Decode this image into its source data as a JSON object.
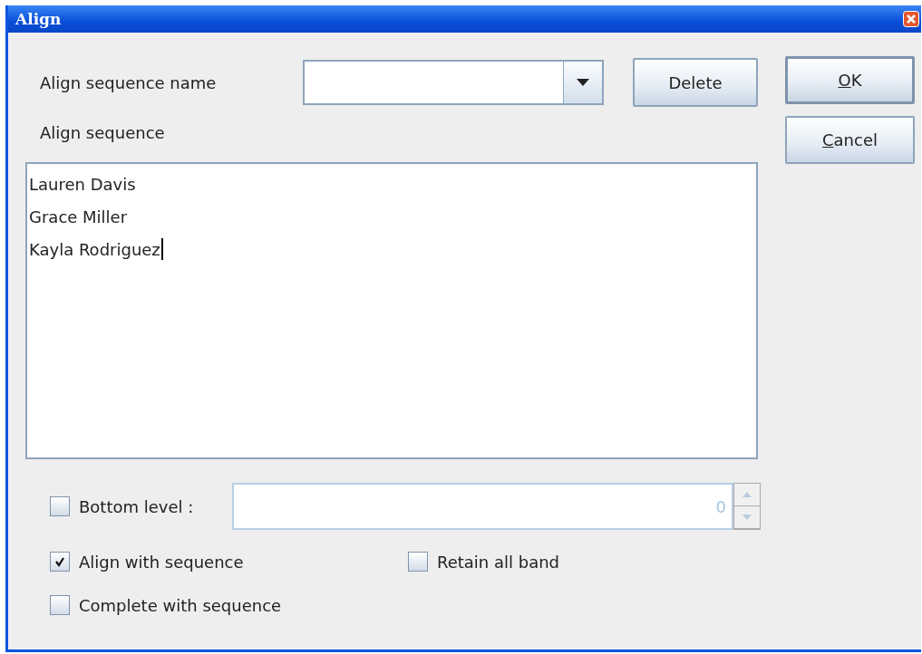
{
  "window": {
    "title": "Align"
  },
  "name_row": {
    "label": "Align sequence name",
    "delete_button": "Delete"
  },
  "sequence": {
    "label": "Align sequence",
    "lines": [
      "Lauren Davis",
      "Grace Miller",
      "Kayla Rodriguez"
    ],
    "focused": true
  },
  "bottom_level": {
    "label": "Bottom level :",
    "checked": false,
    "value": "0",
    "disabled": true
  },
  "options": [
    {
      "label": "Align with sequence",
      "checked": true
    },
    {
      "label": "Retain all band",
      "checked": false
    },
    {
      "label": "Complete with sequence",
      "checked": false
    }
  ],
  "buttons": [
    {
      "label": "OK",
      "mnemonic": true,
      "default": true
    },
    {
      "label": "Cancel",
      "mnemonic": true,
      "default": false
    }
  ]
}
